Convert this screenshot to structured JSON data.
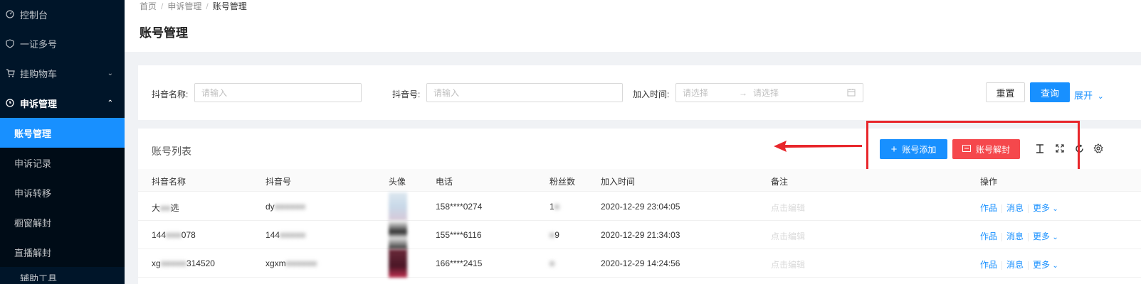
{
  "colors": {
    "sidebar_bg": "#001529",
    "primary": "#1890ff",
    "danger": "#f5484c",
    "annotation": "#e8262b"
  },
  "sidebar": {
    "items": [
      {
        "label": "控制台",
        "icon": "dashboard-icon"
      },
      {
        "label": "一证多号",
        "icon": "shield-icon"
      },
      {
        "label": "挂购物车",
        "icon": "cart-icon"
      },
      {
        "label": "申诉管理",
        "icon": "clock-icon"
      }
    ],
    "submenu": [
      "账号管理",
      "申诉记录",
      "申诉转移",
      "橱窗解封",
      "直播解封"
    ],
    "last_label": "辅助工具"
  },
  "breadcrumb": {
    "home": "首页",
    "mid": "申诉管理",
    "current": "账号管理"
  },
  "page_title": "账号管理",
  "search": {
    "douyin_name_label": "抖音名称:",
    "douyin_name_placeholder": "请输入",
    "douyin_id_label": "抖音号:",
    "douyin_id_placeholder": "请输入",
    "join_time_label": "加入时间:",
    "start_placeholder": "请选择",
    "end_placeholder": "请选择",
    "reset": "重置",
    "query": "查询",
    "expand": "展开"
  },
  "table": {
    "title": "账号列表",
    "add_button": "账号添加",
    "unseal_button": "账号解封",
    "columns": [
      "抖音名称",
      "抖音号",
      "头像",
      "电话",
      "粉丝数",
      "加入时间",
      "备注",
      "操作"
    ],
    "rows": [
      {
        "name": "大",
        "name_tail": "选",
        "id": "dy",
        "phone": "158****0274",
        "fans": "1",
        "time": "2020-12-29 23:04:05",
        "note": "点击编辑"
      },
      {
        "name": "144",
        "name_tail": "078",
        "id": "144",
        "phone": "155****6116",
        "fans": "9",
        "time": "2020-12-29 21:34:03",
        "note": "点击编辑"
      },
      {
        "name": "xg",
        "name_tail": "314520",
        "id": "xgxm",
        "phone": "166****2415",
        "fans": "1",
        "time": "2020-12-29 14:24:56",
        "note": "点击编辑"
      }
    ],
    "ops": {
      "works": "作品",
      "message": "消息",
      "more": "更多"
    }
  }
}
